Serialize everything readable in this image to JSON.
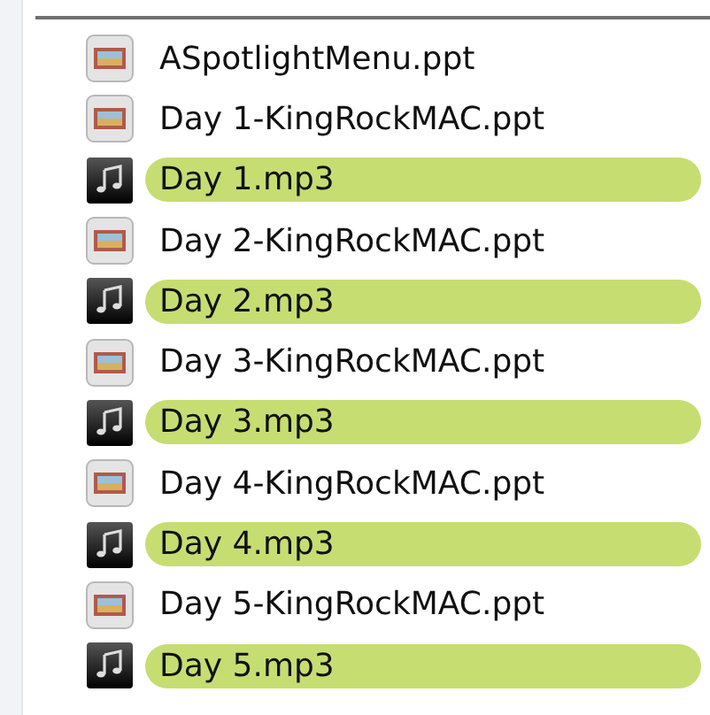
{
  "files": [
    {
      "name": "ASpotlightMenu.ppt",
      "kind": "ppt"
    },
    {
      "name": "Day 1-KingRockMAC.ppt",
      "kind": "ppt"
    },
    {
      "name": "Day 1.mp3",
      "kind": "audio",
      "color": "#c6dd72"
    },
    {
      "name": "Day 2-KingRockMAC.ppt",
      "kind": "ppt"
    },
    {
      "name": "Day 2.mp3",
      "kind": "audio",
      "color": "#c6dd72"
    },
    {
      "name": "Day 3-KingRockMAC.ppt",
      "kind": "ppt"
    },
    {
      "name": "Day 3.mp3",
      "kind": "audio",
      "color": "#c6dd72"
    },
    {
      "name": "Day 4-KingRockMAC.ppt",
      "kind": "ppt"
    },
    {
      "name": "Day 4.mp3",
      "kind": "audio",
      "color": "#c6dd72"
    },
    {
      "name": "Day 5-KingRockMAC.ppt",
      "kind": "ppt"
    },
    {
      "name": "Day 5.mp3",
      "kind": "audio",
      "color": "#c6dd72"
    }
  ]
}
